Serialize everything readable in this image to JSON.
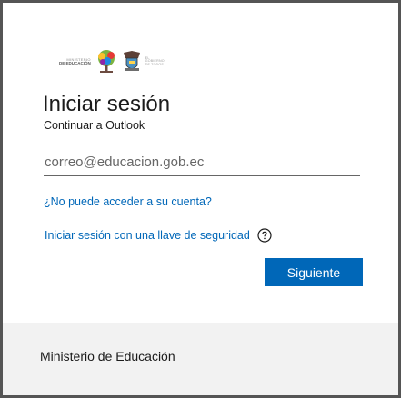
{
  "banner": {
    "ministerio_line1": "MINISTERIO",
    "ministerio_line2": "DE EDUCACIÓN",
    "gobierno_line1": "EL",
    "gobierno_line2": "GOBIERNO",
    "gobierno_line3": "DE TODOS"
  },
  "signin": {
    "title": "Iniciar sesión",
    "subtitle": "Continuar a Outlook",
    "email_placeholder": "correo@educacion.gob.ec",
    "email_value": "",
    "cant_access_link": "¿No puede acceder a su cuenta?",
    "security_key_link": "Iniciar sesión con una llave de seguridad",
    "help_icon": "question-circle-icon",
    "next_button": "Siguiente"
  },
  "footer": {
    "text": "Ministerio de Educación"
  },
  "colors": {
    "accent": "#0067b8",
    "footer_bg": "#f2f2f2",
    "border": "#555555"
  }
}
